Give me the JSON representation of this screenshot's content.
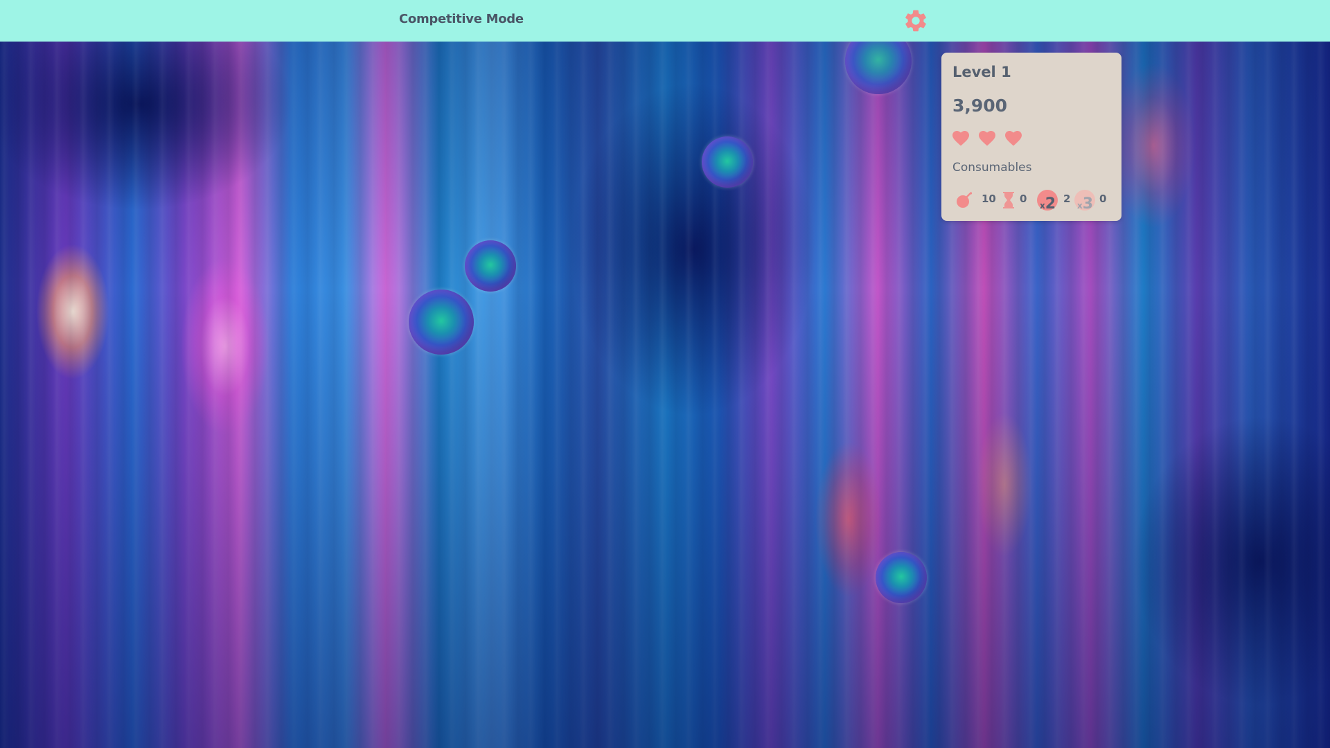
{
  "header": {
    "title": "Competitive Mode",
    "settings_icon": "gear-icon"
  },
  "status_panel": {
    "level": "Level 1",
    "score": "3,900",
    "lives": 3,
    "consumables_label": "Consumables",
    "consumables": [
      {
        "name": "bomb",
        "icon": "bomb-icon",
        "count": "10"
      },
      {
        "name": "hourglass",
        "icon": "hourglass-icon",
        "count": "0"
      },
      {
        "name": "multiplier-x2",
        "icon": "multiplier-x2-icon",
        "label": "2",
        "prefix": "x",
        "count": "2"
      },
      {
        "name": "multiplier-x3",
        "icon": "multiplier-x3-icon",
        "label": "3",
        "prefix": "x",
        "count": "0"
      }
    ]
  },
  "colors": {
    "header_bg": "#9ef4e6",
    "accent": "#f28b8b",
    "panel_bg": "#ded5cb",
    "text": "#55606f"
  }
}
